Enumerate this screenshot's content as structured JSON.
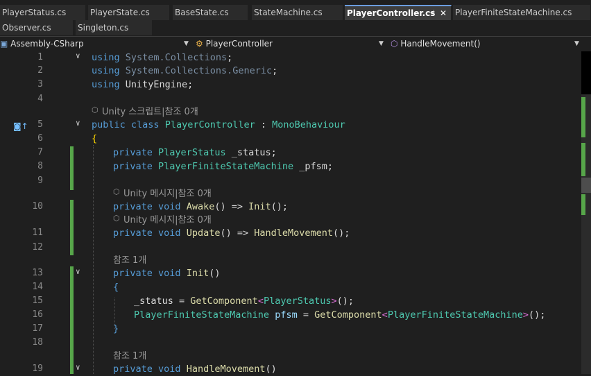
{
  "tabs_row1": [
    {
      "label": "PlayerStatus.cs",
      "active": false
    },
    {
      "label": "PlayerState.cs",
      "active": false
    },
    {
      "label": "BaseState.cs",
      "active": false
    },
    {
      "label": "StateMachine.cs",
      "active": false
    },
    {
      "label": "PlayerController.cs",
      "active": true
    },
    {
      "label": "PlayerFiniteStateMachine.cs",
      "active": false
    }
  ],
  "tabs_row2": [
    {
      "label": "Observer.cs"
    },
    {
      "label": "Singleton.cs"
    }
  ],
  "tab_icons": {
    "pin": "pin-icon",
    "close": "close-icon"
  },
  "navbar": {
    "project": "Assembly-CSharp",
    "class": "PlayerController",
    "member": "HandleMovement()"
  },
  "codelens": {
    "unity_script": "Unity 스크립트|참조 0개",
    "unity_message": "Unity 메시지|참조 0개",
    "ref_one": "참조 1개"
  },
  "lines": [
    {
      "n": "1",
      "code": "using System.Collections;"
    },
    {
      "n": "2",
      "code": "using System.Collections.Generic;"
    },
    {
      "n": "3",
      "code": "using UnityEngine;"
    },
    {
      "n": "4",
      "code": ""
    },
    {
      "n": "5",
      "code": "public class PlayerController : MonoBehaviour"
    },
    {
      "n": "6",
      "code": "{"
    },
    {
      "n": "7",
      "code": "private PlayerStatus _status;"
    },
    {
      "n": "8",
      "code": "private PlayerFiniteStateMachine _pfsm;"
    },
    {
      "n": "9",
      "code": ""
    },
    {
      "n": "10",
      "code": "private void Awake() => Init();"
    },
    {
      "n": "11",
      "code": "private void Update() => HandleMovement();"
    },
    {
      "n": "12",
      "code": ""
    },
    {
      "n": "13",
      "code": "private void Init()"
    },
    {
      "n": "14",
      "code": "{"
    },
    {
      "n": "15",
      "code": "_status = GetComponent<PlayerStatus>();"
    },
    {
      "n": "16",
      "code": "PlayerFiniteStateMachine pfsm = GetComponent<PlayerFiniteStateMachine>();"
    },
    {
      "n": "17",
      "code": "}"
    },
    {
      "n": "18",
      "code": ""
    },
    {
      "n": "19",
      "code": "private void HandleMovement()"
    }
  ],
  "colors": {
    "keyword": "#569cd6",
    "type": "#4ec9b0",
    "method": "#dcdcaa",
    "modified_bar": "#57a64a",
    "active_tab_accent": "#6b9ddf"
  }
}
